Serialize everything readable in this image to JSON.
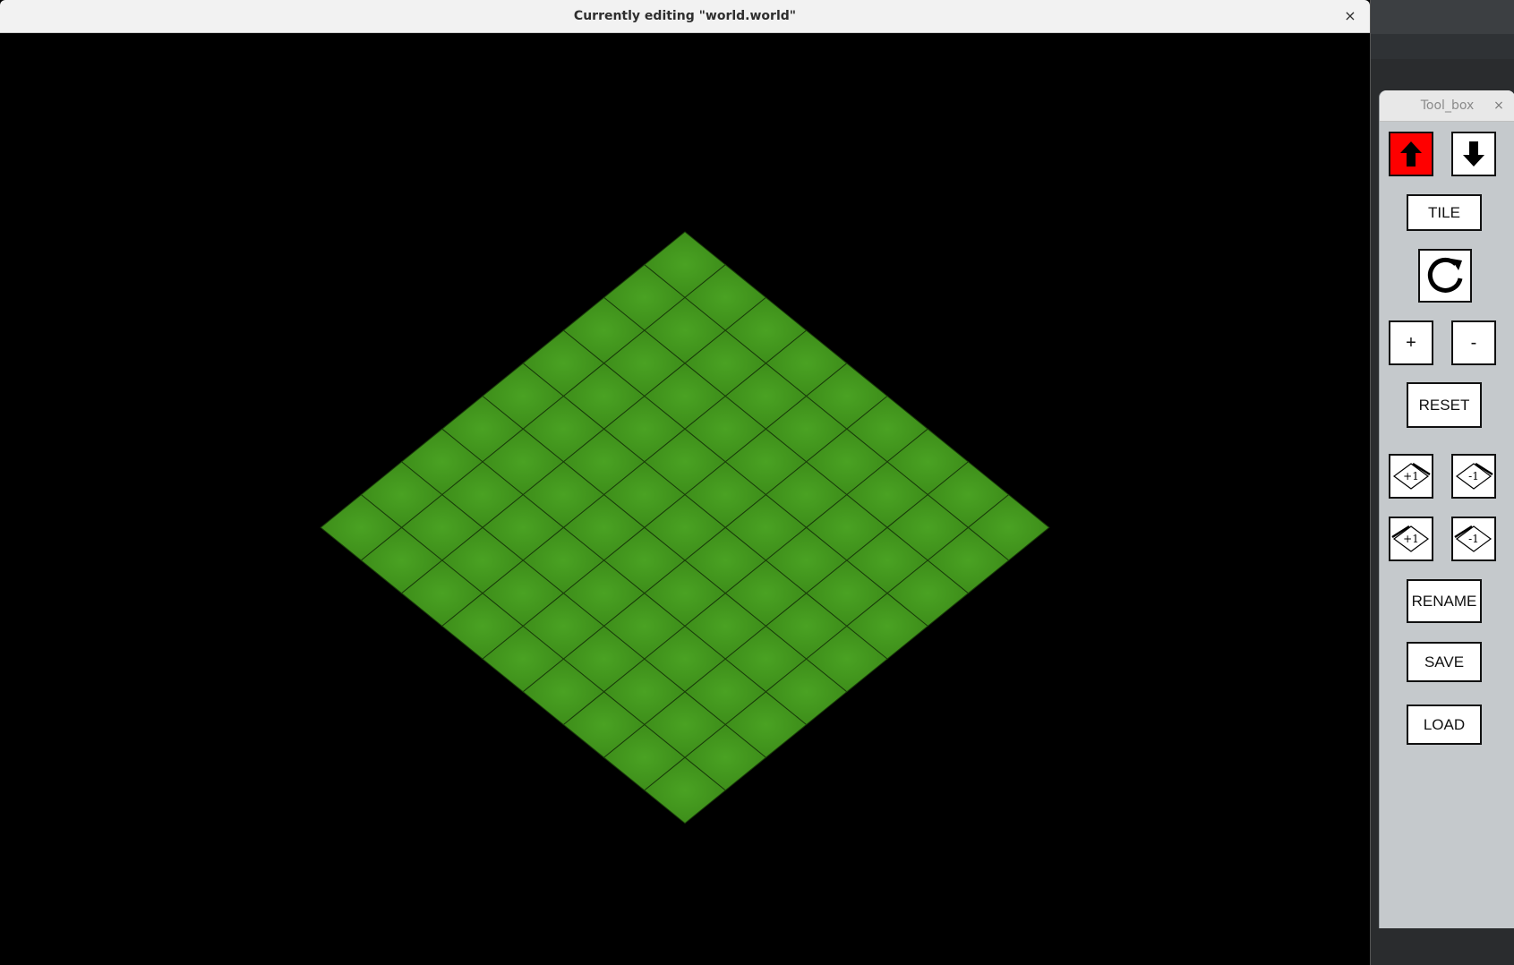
{
  "window": {
    "title": "Currently editing \"world.world\"",
    "close_glyph": "×"
  },
  "toolbox": {
    "title": "Tool_box",
    "close_glyph": "×",
    "buttons": {
      "raise": {
        "icon": "arrow-up-icon",
        "active": true,
        "active_color": "#ff0000"
      },
      "lower": {
        "icon": "arrow-down-icon",
        "active": false
      },
      "tile": "TILE",
      "rotate": {
        "icon": "rotate-icon"
      },
      "plus": "+",
      "minus": "-",
      "reset": "RESET",
      "corner_plus_right": "+1",
      "corner_minus_right": "-1",
      "corner_plus_left": "+1",
      "corner_minus_left": "-1",
      "rename": "RENAME",
      "save": "SAVE",
      "load": "LOAD"
    }
  },
  "map": {
    "grid_size": 9,
    "tile_color": "#3f8f1a",
    "tile_color_light": "#4aa223",
    "grid_line_color": "#1a3d0a",
    "background": "#000000"
  }
}
